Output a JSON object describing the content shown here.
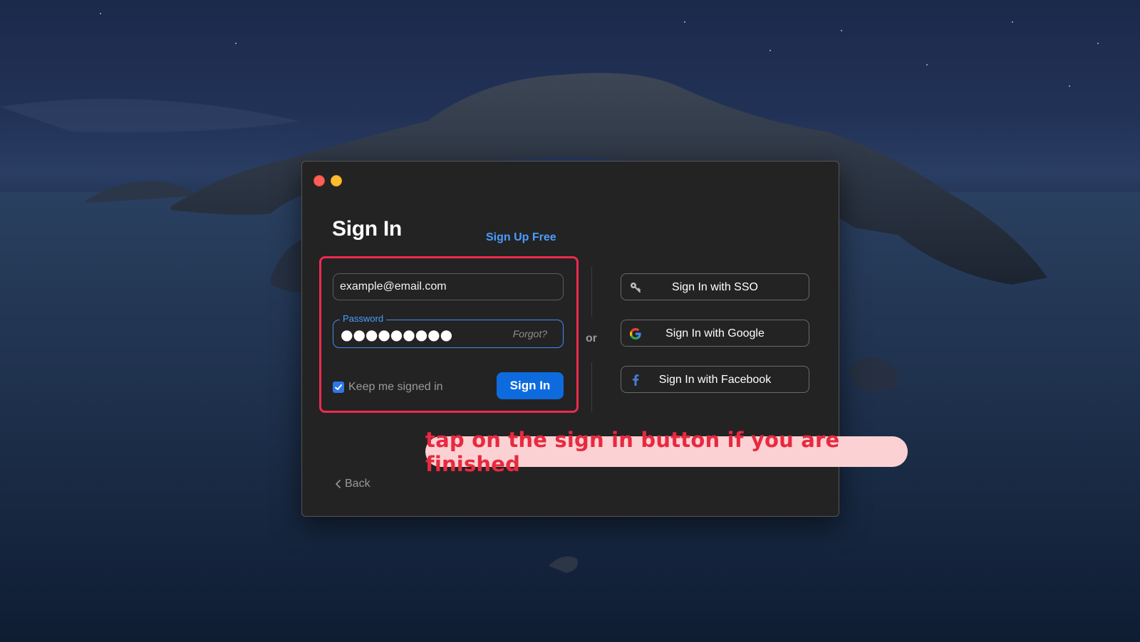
{
  "window": {
    "title": "Sign In",
    "signup_link": "Sign Up Free"
  },
  "form": {
    "email_value": "example@email.com",
    "password_label": "Password",
    "password_masked": "●●●●●●●●●",
    "forgot_link": "Forgot?",
    "keep_signed_in_label": "Keep me signed in",
    "keep_signed_in_checked": true,
    "signin_button": "Sign In"
  },
  "separator": "or",
  "alt_signin": {
    "sso": {
      "label": "Sign In with SSO",
      "icon": "key-icon"
    },
    "google": {
      "label": "Sign In with Google",
      "icon": "google-icon"
    },
    "facebook": {
      "label": "Sign In with Facebook",
      "icon": "facebook-icon"
    }
  },
  "back_link": "Back",
  "annotation": {
    "tip_text": "tap on the sign in button if you are finished",
    "highlight_color": "#ee2a4e"
  },
  "colors": {
    "accent": "#0d6bde",
    "link": "#4a9dff",
    "window_bg": "#232323",
    "traffic_close": "#fe5f57",
    "traffic_min": "#febc2e"
  }
}
